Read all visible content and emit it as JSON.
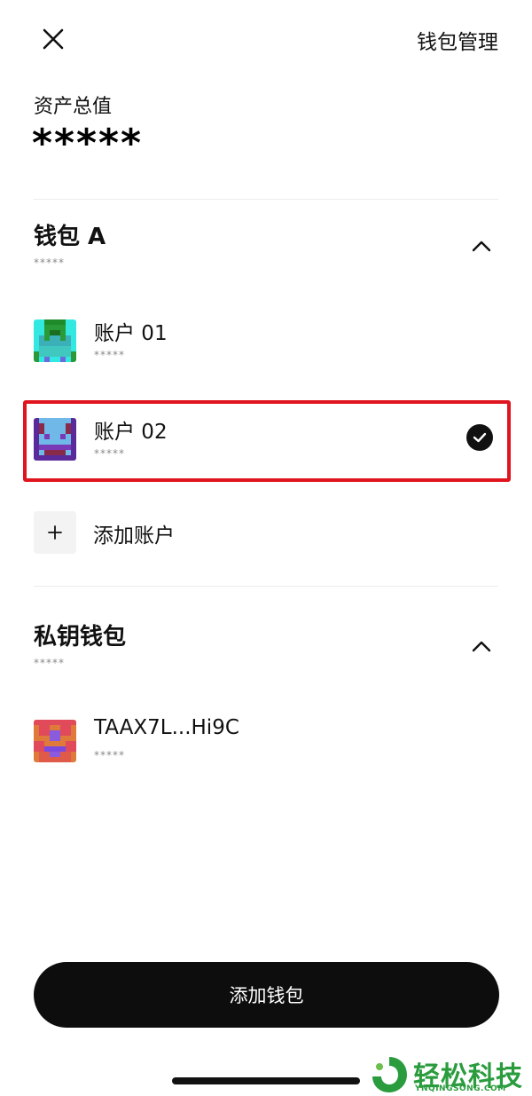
{
  "header": {
    "close_icon": "close-icon",
    "manage_label": "钱包管理"
  },
  "assets": {
    "label": "资产总值",
    "value": "*****"
  },
  "groups": [
    {
      "title": "钱包 A",
      "subtitle": "*****",
      "expanded": true,
      "accounts": [
        {
          "name": "账户 01",
          "sub": "*****",
          "avatar": "pixel-avatar-cyan-green",
          "selected": false
        },
        {
          "name": "账户 02",
          "sub": "*****",
          "avatar": "pixel-avatar-blue-purple",
          "selected": true
        }
      ],
      "add_account_label": "添加账户"
    },
    {
      "title": "私钥钱包",
      "subtitle": "*****",
      "expanded": true,
      "accounts": [
        {
          "name": "TAAX7L...Hi9C",
          "sub": "*****",
          "avatar": "pixel-avatar-red-orange",
          "selected": false
        }
      ]
    }
  ],
  "footer": {
    "add_wallet_label": "添加钱包"
  },
  "watermark": {
    "text": "轻松科技",
    "sub": "YNQINGSONG.COM"
  },
  "colors": {
    "highlight": "#e0141e",
    "button_bg": "#0d0d0d",
    "watermark": "#2a9c3e"
  }
}
